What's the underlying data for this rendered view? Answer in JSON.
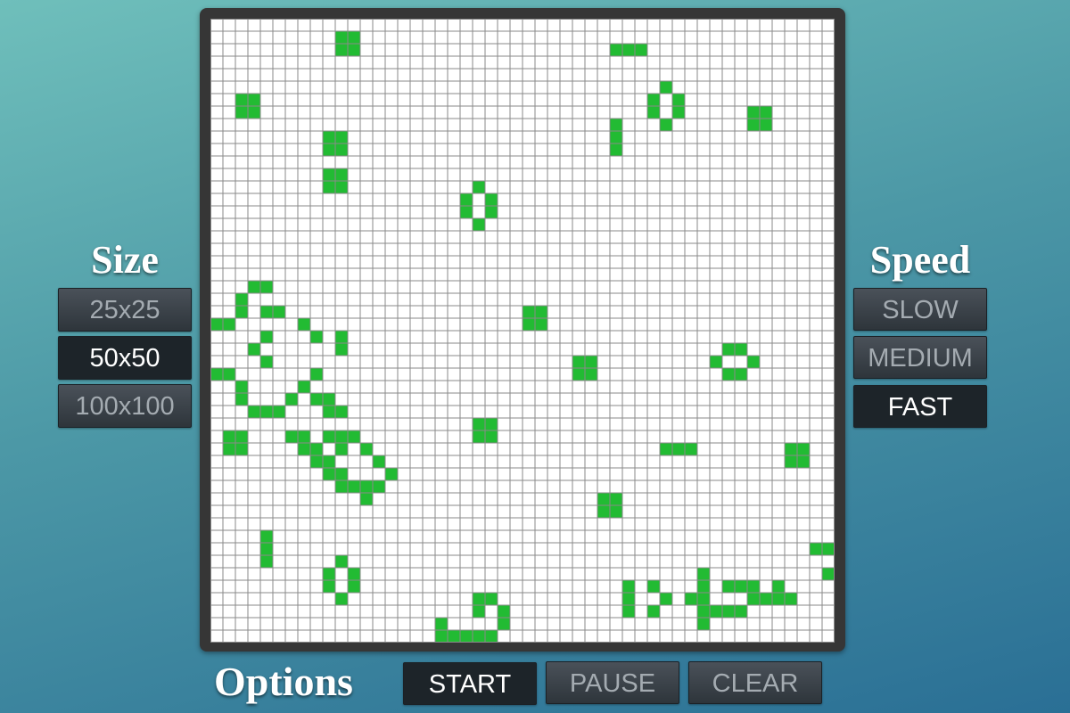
{
  "size_panel": {
    "title": "Size",
    "buttons": [
      {
        "label": "25x25",
        "active": false
      },
      {
        "label": "50x50",
        "active": true
      },
      {
        "label": "100x100",
        "active": false
      }
    ]
  },
  "speed_panel": {
    "title": "Speed",
    "buttons": [
      {
        "label": "SLOW",
        "active": false
      },
      {
        "label": "MEDIUM",
        "active": false
      },
      {
        "label": "FAST",
        "active": true
      }
    ]
  },
  "options_panel": {
    "title": "Options",
    "buttons": [
      {
        "label": "START",
        "active": true
      },
      {
        "label": "PAUSE",
        "active": false
      },
      {
        "label": "CLEAR",
        "active": false
      }
    ]
  },
  "board": {
    "cols": 50,
    "rows": 50,
    "colors": {
      "alive": "#22bb33",
      "dead": "#ffffff",
      "grid_line": "#8a8a8a"
    },
    "live_cells": [
      [
        10,
        1
      ],
      [
        11,
        1
      ],
      [
        10,
        2
      ],
      [
        11,
        2
      ],
      [
        32,
        2
      ],
      [
        33,
        2
      ],
      [
        34,
        2
      ],
      [
        36,
        5
      ],
      [
        35,
        6
      ],
      [
        37,
        6
      ],
      [
        35,
        7
      ],
      [
        37,
        7
      ],
      [
        36,
        8
      ],
      [
        2,
        6
      ],
      [
        3,
        6
      ],
      [
        2,
        7
      ],
      [
        3,
        7
      ],
      [
        43,
        7
      ],
      [
        44,
        7
      ],
      [
        43,
        8
      ],
      [
        44,
        8
      ],
      [
        32,
        8
      ],
      [
        32,
        9
      ],
      [
        32,
        10
      ],
      [
        9,
        9
      ],
      [
        10,
        9
      ],
      [
        9,
        10
      ],
      [
        10,
        10
      ],
      [
        9,
        12
      ],
      [
        10,
        12
      ],
      [
        9,
        13
      ],
      [
        10,
        13
      ],
      [
        21,
        13
      ],
      [
        20,
        14
      ],
      [
        22,
        14
      ],
      [
        20,
        15
      ],
      [
        22,
        15
      ],
      [
        21,
        16
      ],
      [
        3,
        21
      ],
      [
        4,
        21
      ],
      [
        2,
        22
      ],
      [
        2,
        23
      ],
      [
        4,
        23
      ],
      [
        5,
        23
      ],
      [
        0,
        24
      ],
      [
        1,
        24
      ],
      [
        7,
        24
      ],
      [
        4,
        25
      ],
      [
        8,
        25
      ],
      [
        10,
        25
      ],
      [
        3,
        26
      ],
      [
        10,
        26
      ],
      [
        4,
        27
      ],
      [
        25,
        23
      ],
      [
        26,
        23
      ],
      [
        25,
        24
      ],
      [
        26,
        24
      ],
      [
        41,
        26
      ],
      [
        42,
        26
      ],
      [
        40,
        27
      ],
      [
        43,
        27
      ],
      [
        41,
        28
      ],
      [
        42,
        28
      ],
      [
        29,
        27
      ],
      [
        30,
        27
      ],
      [
        29,
        28
      ],
      [
        30,
        28
      ],
      [
        0,
        28
      ],
      [
        1,
        28
      ],
      [
        8,
        28
      ],
      [
        2,
        29
      ],
      [
        7,
        29
      ],
      [
        2,
        30
      ],
      [
        6,
        30
      ],
      [
        8,
        30
      ],
      [
        9,
        30
      ],
      [
        3,
        31
      ],
      [
        4,
        31
      ],
      [
        5,
        31
      ],
      [
        9,
        31
      ],
      [
        10,
        31
      ],
      [
        21,
        32
      ],
      [
        22,
        32
      ],
      [
        21,
        33
      ],
      [
        22,
        33
      ],
      [
        1,
        33
      ],
      [
        2,
        33
      ],
      [
        6,
        33
      ],
      [
        7,
        33
      ],
      [
        9,
        33
      ],
      [
        10,
        33
      ],
      [
        11,
        33
      ],
      [
        1,
        34
      ],
      [
        2,
        34
      ],
      [
        7,
        34
      ],
      [
        8,
        34
      ],
      [
        10,
        34
      ],
      [
        12,
        34
      ],
      [
        8,
        35
      ],
      [
        9,
        35
      ],
      [
        13,
        35
      ],
      [
        36,
        34
      ],
      [
        37,
        34
      ],
      [
        38,
        34
      ],
      [
        46,
        34
      ],
      [
        47,
        34
      ],
      [
        46,
        35
      ],
      [
        47,
        35
      ],
      [
        9,
        36
      ],
      [
        10,
        36
      ],
      [
        14,
        36
      ],
      [
        10,
        37
      ],
      [
        11,
        37
      ],
      [
        12,
        37
      ],
      [
        13,
        37
      ],
      [
        12,
        38
      ],
      [
        31,
        38
      ],
      [
        32,
        38
      ],
      [
        31,
        39
      ],
      [
        32,
        39
      ],
      [
        4,
        41
      ],
      [
        4,
        42
      ],
      [
        4,
        43
      ],
      [
        48,
        42
      ],
      [
        49,
        42
      ],
      [
        10,
        43
      ],
      [
        9,
        44
      ],
      [
        11,
        44
      ],
      [
        9,
        45
      ],
      [
        11,
        45
      ],
      [
        10,
        46
      ],
      [
        49,
        44
      ],
      [
        39,
        44
      ],
      [
        33,
        45
      ],
      [
        35,
        45
      ],
      [
        39,
        45
      ],
      [
        41,
        45
      ],
      [
        42,
        45
      ],
      [
        43,
        45
      ],
      [
        45,
        45
      ],
      [
        33,
        46
      ],
      [
        36,
        46
      ],
      [
        38,
        46
      ],
      [
        39,
        46
      ],
      [
        43,
        46
      ],
      [
        44,
        46
      ],
      [
        45,
        46
      ],
      [
        46,
        46
      ],
      [
        21,
        46
      ],
      [
        22,
        46
      ],
      [
        21,
        47
      ],
      [
        23,
        47
      ],
      [
        33,
        47
      ],
      [
        35,
        47
      ],
      [
        39,
        47
      ],
      [
        40,
        47
      ],
      [
        41,
        47
      ],
      [
        42,
        47
      ],
      [
        18,
        48
      ],
      [
        23,
        48
      ],
      [
        39,
        48
      ],
      [
        18,
        49
      ],
      [
        19,
        49
      ],
      [
        20,
        49
      ],
      [
        21,
        49
      ],
      [
        22,
        49
      ]
    ]
  }
}
